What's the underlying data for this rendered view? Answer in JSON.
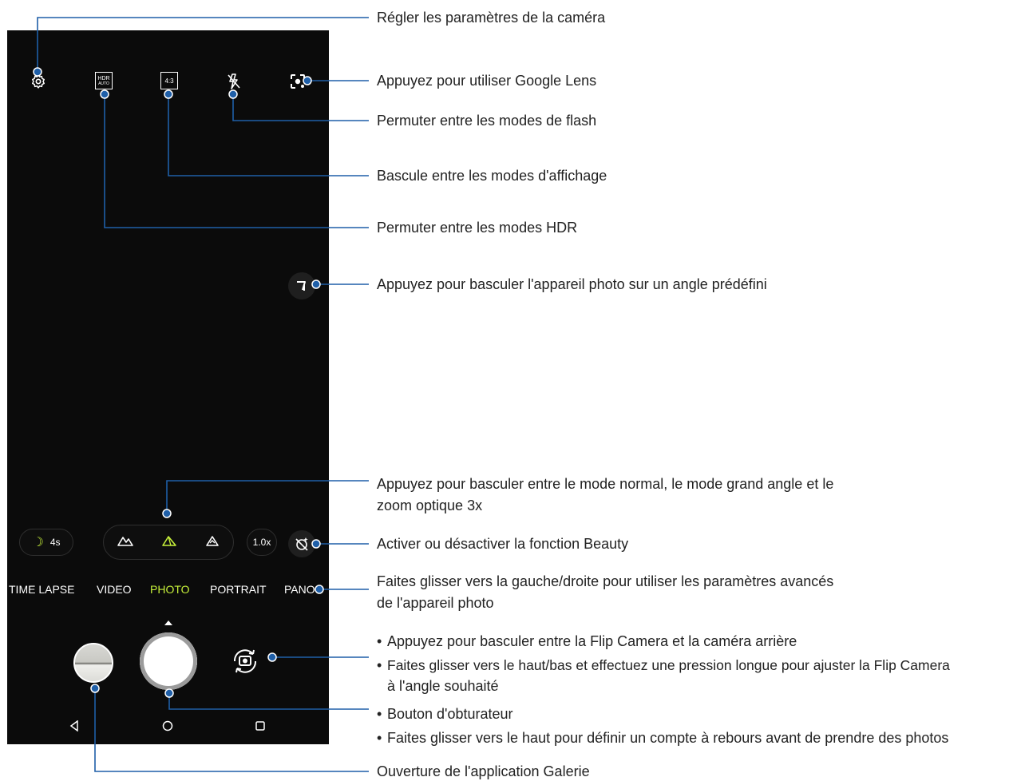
{
  "colors": {
    "screen_bg": "#0b0b0b",
    "accent_green": "#c6f03a",
    "callout_line": "#1f5fa8",
    "text": "#222222"
  },
  "topbar": {
    "icons": [
      "settings-icon",
      "hdr-auto-icon",
      "aspect-ratio-icon",
      "flash-off-icon",
      "google-lens-icon"
    ],
    "hdr_line1": "HDR",
    "hdr_line2": "AUTO",
    "aspect_label": "4:3"
  },
  "controls": {
    "night_label": "4s",
    "zoom_label": "1.0x",
    "lens_modes": [
      "normal-lens-icon",
      "wide-angle-lens-icon",
      "telephoto-lens-icon"
    ],
    "selected_lens": 1
  },
  "modes": {
    "items": [
      "TIME LAPSE",
      "VIDEO",
      "PHOTO",
      "PORTRAIT",
      "PANO"
    ],
    "selected": "PHOTO"
  },
  "navbar": {
    "icons": [
      "back-icon",
      "home-icon",
      "recents-icon"
    ]
  },
  "callouts": {
    "settings": "Régler les paramètres de la caméra",
    "lens": "Appuyez pour utiliser Google Lens",
    "flash": "Permuter entre les modes de flash",
    "display": "Bascule entre les modes d'affichage",
    "hdr": "Permuter entre les modes HDR",
    "angle": "Appuyez pour basculer l'appareil photo sur un angle prédéfini",
    "zoom_line1": "Appuyez pour basculer entre le mode normal, le mode grand angle et le",
    "zoom_line2": "zoom optique 3x",
    "beauty": "Activer ou désactiver la fonction Beauty",
    "swipe_line1": "Faites glisser vers la gauche/droite pour utiliser les paramètres avancés",
    "swipe_line2": "de l'appareil photo",
    "flip_bullet1": "Appuyez pour basculer entre la Flip Camera et la caméra arrière",
    "flip_bullet2_line1": "Faites glisser vers le haut/bas et effectuez une pression longue pour ajuster la Flip Camera",
    "flip_bullet2_line2": "à l'angle souhaité",
    "shutter_bullet1": "Bouton d'obturateur",
    "shutter_bullet2": "Faites glisser vers le haut pour définir un compte à rebours avant de prendre des photos",
    "gallery": "Ouverture de l'application Galerie"
  }
}
